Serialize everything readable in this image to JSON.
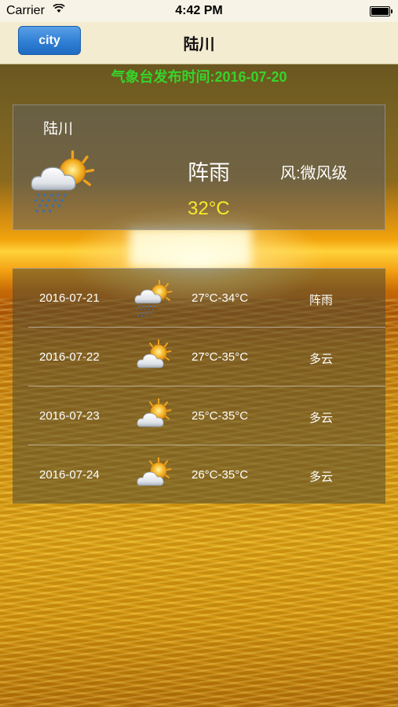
{
  "status_bar": {
    "carrier": "Carrier",
    "time": "4:42 PM"
  },
  "nav": {
    "city_button_label": "city",
    "title": "陆川"
  },
  "publish_time": "气象台发布时间:2016-07-20",
  "current": {
    "city": "陆川",
    "weather": "阵雨",
    "wind": "风:微风级",
    "temperature": "32°C",
    "icon": "sun-cloud-rain-icon"
  },
  "forecast": [
    {
      "date": "2016-07-21",
      "temp": "27°C-34°C",
      "weather": "阵雨",
      "icon": "sun-cloud-rain-icon"
    },
    {
      "date": "2016-07-22",
      "temp": "27°C-35°C",
      "weather": "多云",
      "icon": "sun-cloud-icon"
    },
    {
      "date": "2016-07-23",
      "temp": "25°C-35°C",
      "weather": "多云",
      "icon": "sun-cloud-icon"
    },
    {
      "date": "2016-07-24",
      "temp": "26°C-35°C",
      "weather": "多云",
      "icon": "sun-cloud-icon"
    }
  ],
  "colors": {
    "publish_time": "#36d42a",
    "current_temp": "#f6e92a",
    "city_button": "#2f7fd4"
  }
}
